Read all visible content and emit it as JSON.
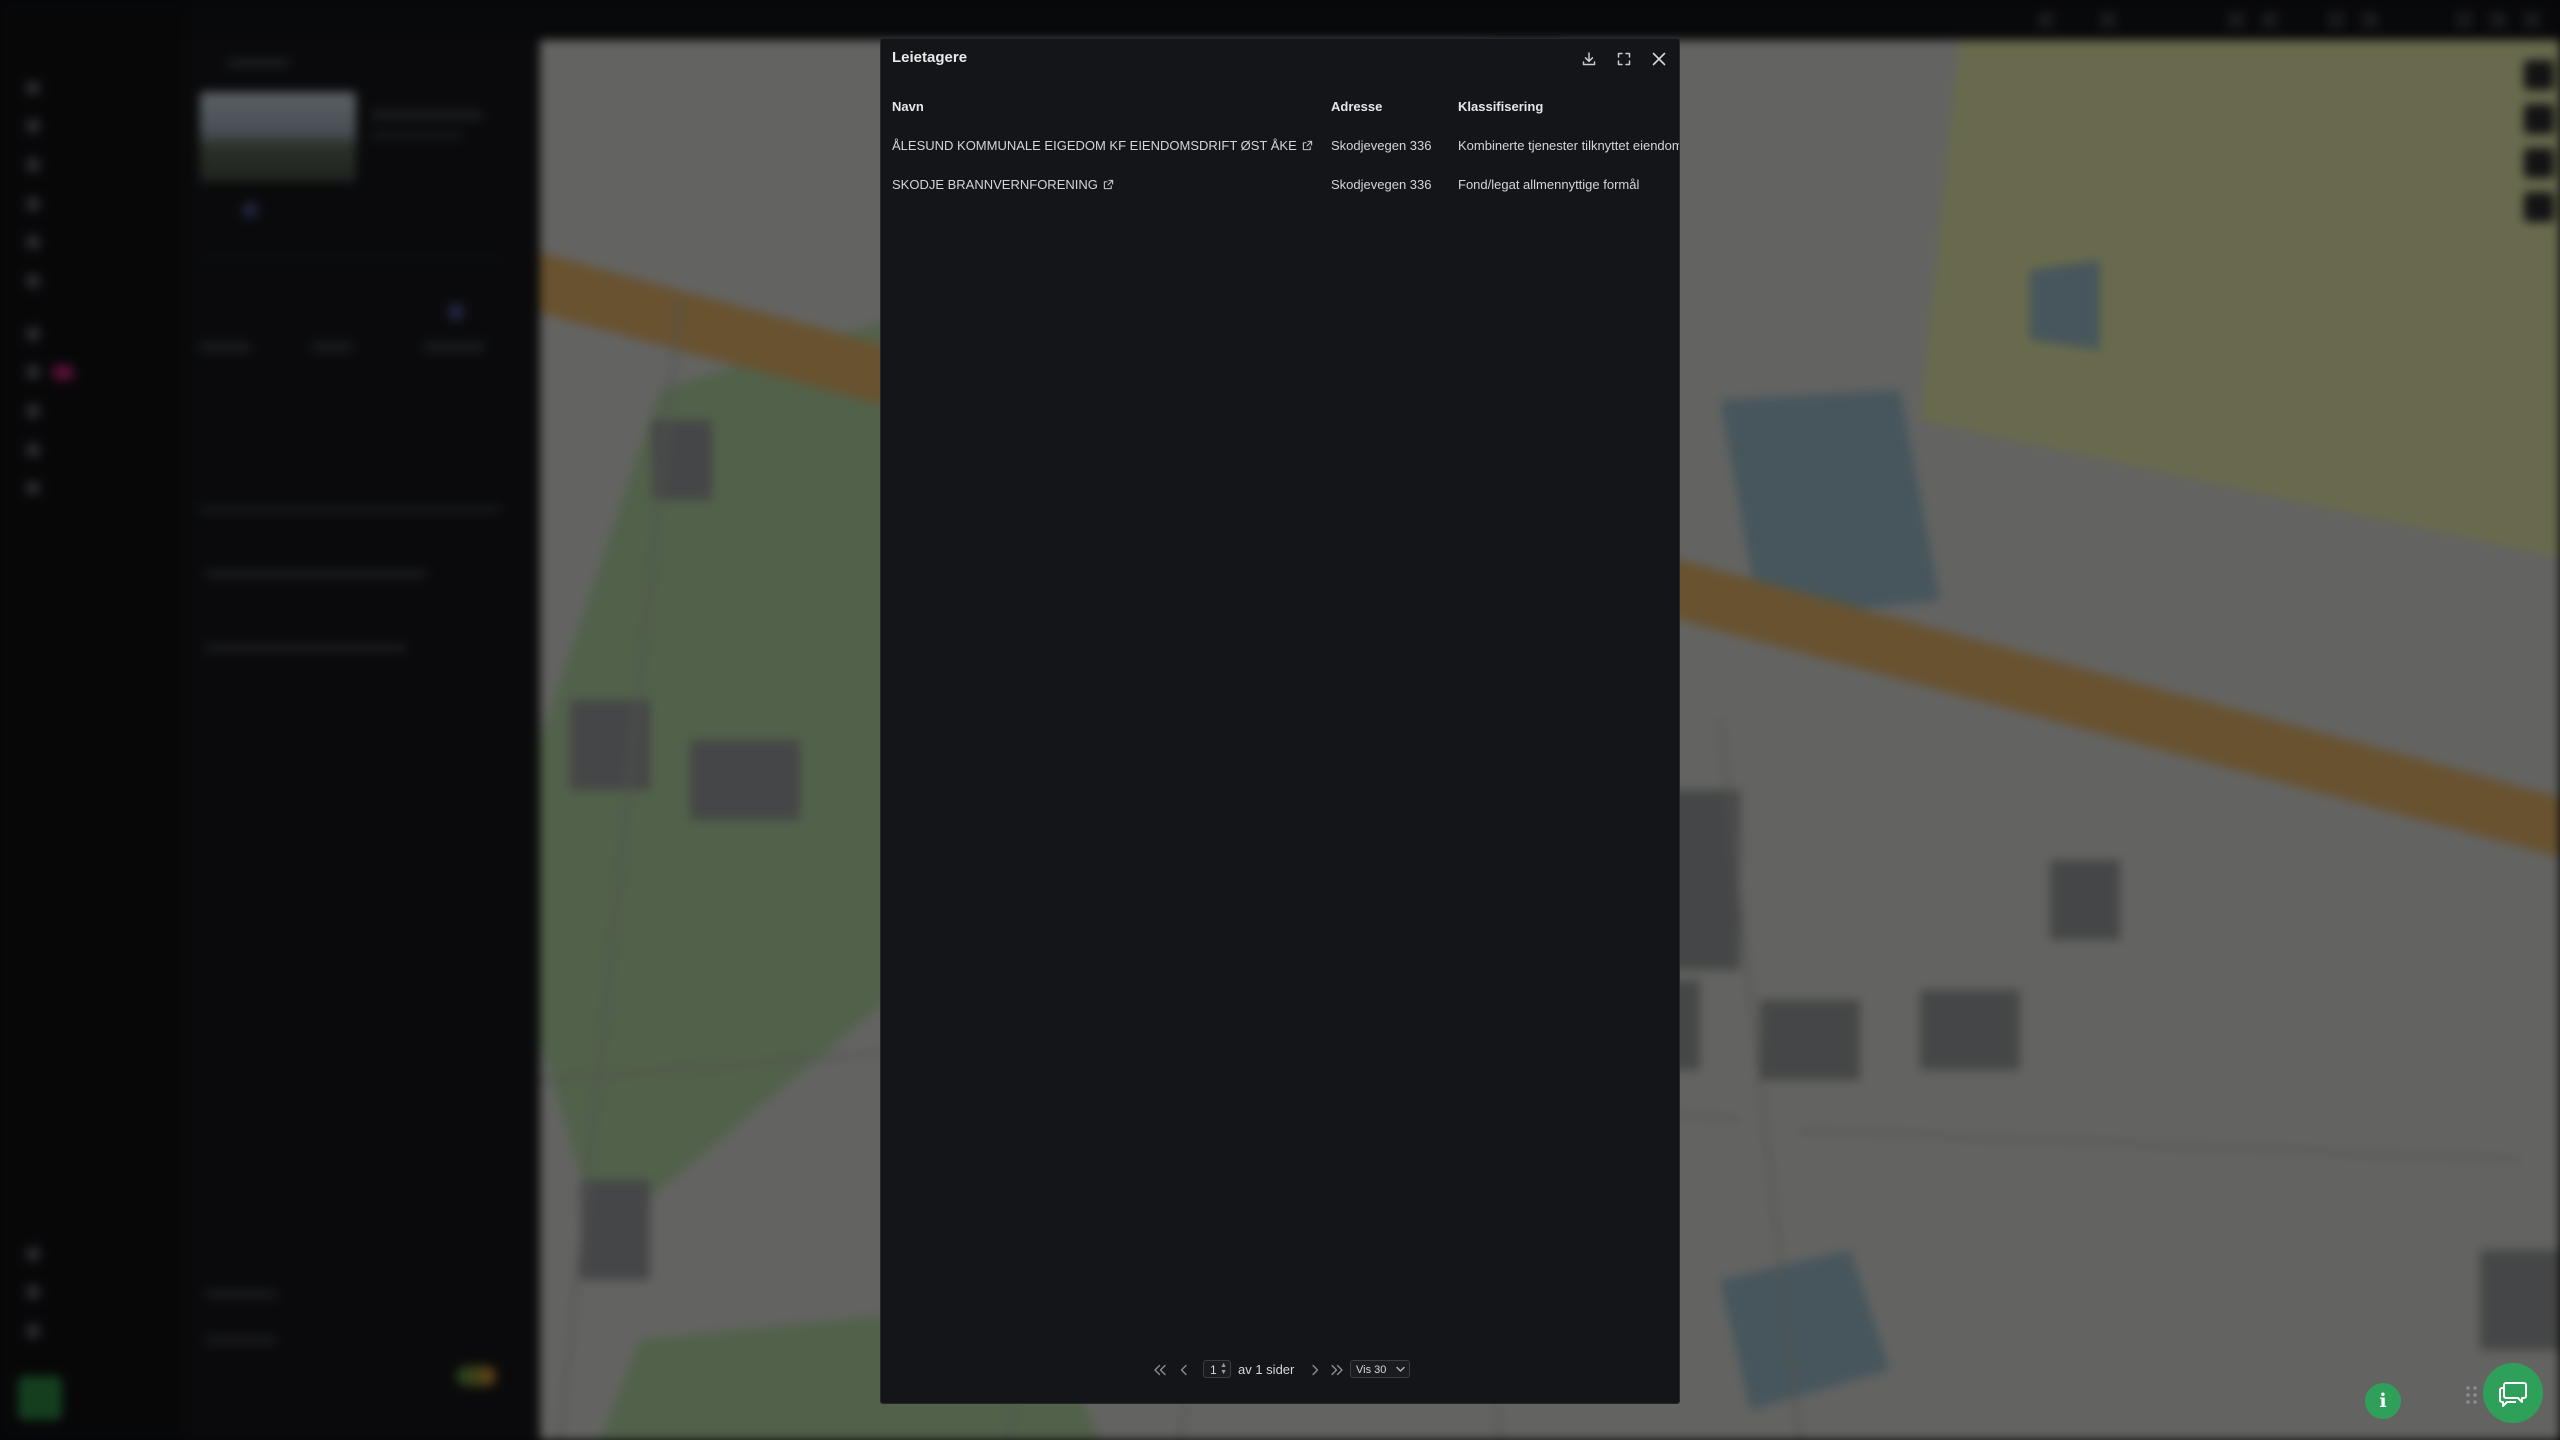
{
  "modal": {
    "title": "Leietagere",
    "columns": [
      "Navn",
      "Adresse",
      "Klassifisering"
    ],
    "rows": [
      {
        "name": "ÅLESUND KOMMUNALE EIGEDOM KF EIENDOMSDRIFT ØST ÅKE",
        "address": "Skodjevegen 336",
        "classification": "Kombinerte tjenester tilknyttet eiendomsdrift"
      },
      {
        "name": "SKODJE BRANNVERNFORENING",
        "address": "Skodjevegen 336",
        "classification": "Fond/legat allmennyttige formål"
      }
    ],
    "pagination": {
      "current_page": "1",
      "of_pages": "av 1 sider",
      "per_page": "Vis 30"
    }
  },
  "colors": {
    "modal_bg": "#141518",
    "accent_green": "#2fa05a",
    "nav_badge": "#c2247a"
  },
  "icons": {
    "download": "download-icon",
    "fullscreen": "fullscreen-icon",
    "close": "close-icon",
    "external_link": "external-link-icon",
    "first_page": "chevrons-left-icon",
    "prev_page": "chevron-left-icon",
    "next_page": "chevron-right-icon",
    "last_page": "chevrons-right-icon",
    "info": "info-icon",
    "chat": "chat-icon"
  }
}
